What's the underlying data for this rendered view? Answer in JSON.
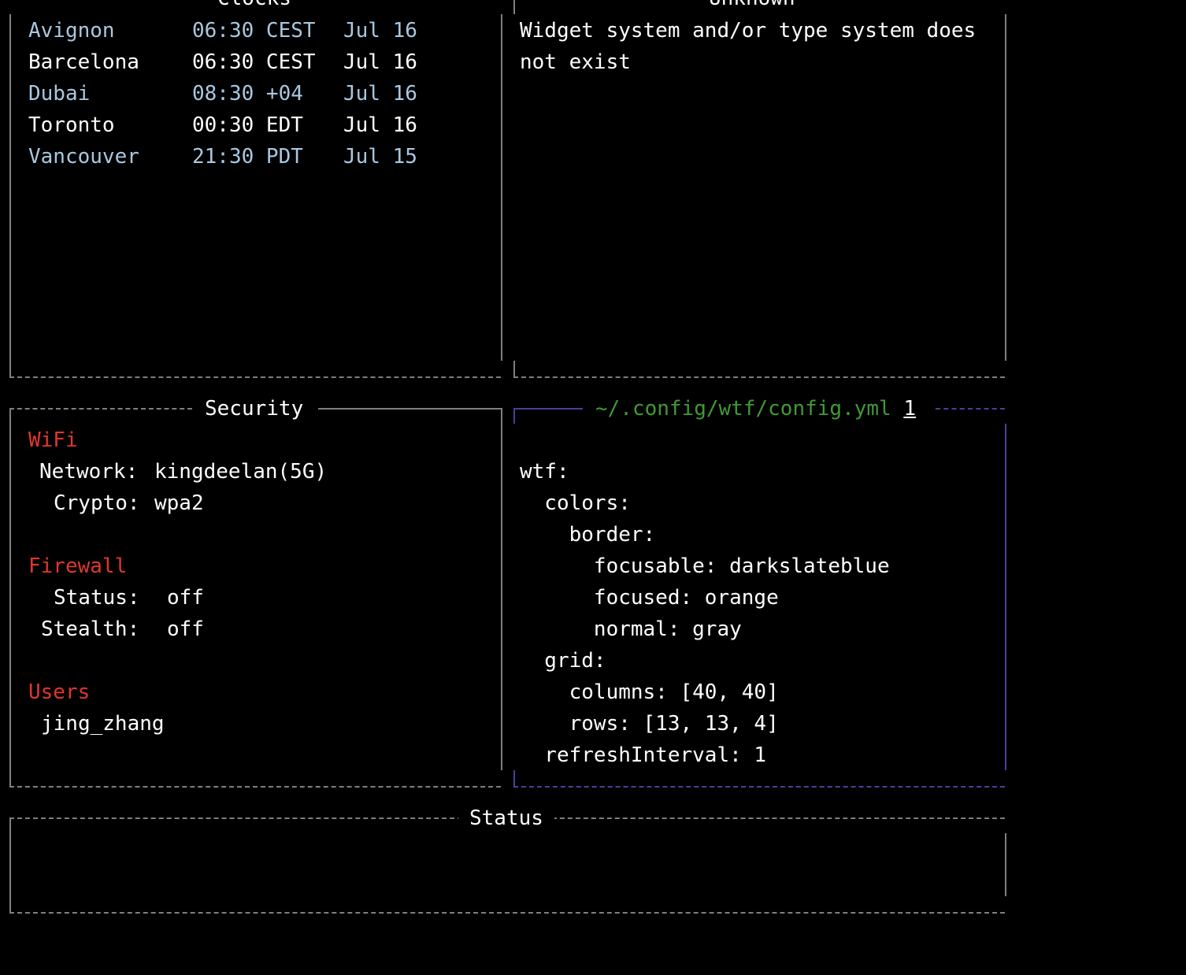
{
  "colors": {
    "background": "#000000",
    "border_normal": "#7f7f7f",
    "border_focusable": "#4b3f9a",
    "text": "#ffffff",
    "text_alt": "#a9c8e0",
    "section_header": "#e0372c",
    "config_title": "#3f9a35"
  },
  "clocks": {
    "title": "Clocks",
    "rows": [
      {
        "city": "Avignon",
        "time": "06:30 CEST",
        "date": "Jul 16"
      },
      {
        "city": "Barcelona",
        "time": "06:30 CEST",
        "date": "Jul 16"
      },
      {
        "city": "Dubai",
        "time": "08:30 +04",
        "date": "Jul 16"
      },
      {
        "city": "Toronto",
        "time": "00:30 EDT",
        "date": "Jul 16"
      },
      {
        "city": "Vancouver",
        "time": "21:30 PDT",
        "date": "Jul 15"
      }
    ]
  },
  "unknown": {
    "title": "Unknown",
    "message_line1": "Widget system and/or type system does",
    "message_line2": "not exist"
  },
  "security": {
    "title": "Security",
    "wifi_header": "WiFi",
    "network_label": "Network:",
    "network_value": "kingdeelan(5G)",
    "crypto_label": "Crypto:",
    "crypto_value": "wpa2",
    "firewall_header": "Firewall",
    "status_label": "Status:",
    "status_value": "off",
    "stealth_label": "Stealth:",
    "stealth_value": "off",
    "users_header": "Users",
    "user_1": "jing_zhang"
  },
  "config": {
    "title": "~/.config/wtf/config.yml",
    "title_index": "1",
    "lines": [
      "wtf:",
      "  colors:",
      "    border:",
      "      focusable: darkslateblue",
      "      focused: orange",
      "      normal: gray",
      "  grid:",
      "    columns: [40, 40]",
      "    rows: [13, 13, 4]",
      "  refreshInterval: 1"
    ]
  },
  "status": {
    "title": "Status"
  }
}
